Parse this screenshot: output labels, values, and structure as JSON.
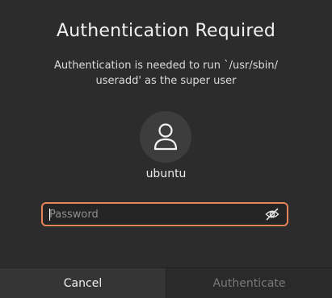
{
  "dialog": {
    "title": "Authentication Required",
    "message_line1": "Authentication is needed to run `/usr/sbin/",
    "message_line2": "useradd' as the super user",
    "avatar_icon": "user-icon",
    "username": "ubuntu",
    "password_placeholder": "Password",
    "password_value": "",
    "visibility_icon": "eye-slash-icon",
    "cancel_label": "Cancel",
    "authenticate_label": "Authenticate"
  },
  "colors": {
    "background": "#2c2c2c",
    "focus_border": "#e9835c",
    "disabled_text": "#7a7a7a"
  }
}
